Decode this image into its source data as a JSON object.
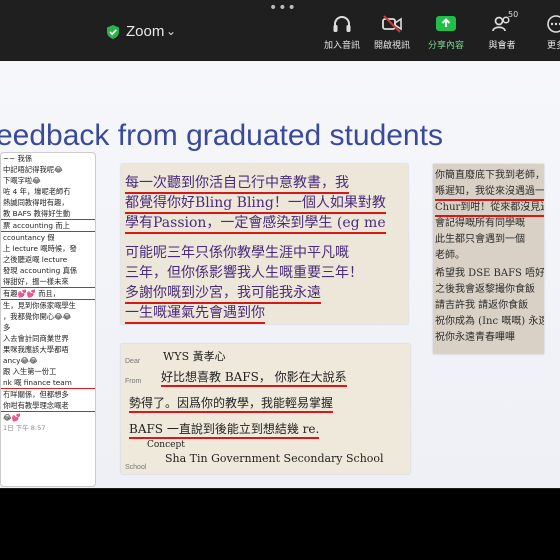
{
  "topbar": {
    "dots": "•••",
    "app_name": "Zoom",
    "buttons": [
      {
        "label": "加入音訊"
      },
      {
        "label": "開啟視訊"
      },
      {
        "label": "分享內容"
      },
      {
        "label": "與會者",
        "count": "50"
      },
      {
        "label": "更多"
      }
    ]
  },
  "slide": {
    "title": "eedback from graduated students",
    "chat_lines": [
      "~~ 我係",
      "中記唔記得我呢😂",
      "",
      "下嘅字啦😂",
      "咗 4 年，壕呢老師冇",
      "熱誠同教得咁有趣，",
      "教 BAFS 教得好生動",
      "票 accounting 而上",
      "ccountancy 假",
      "上 lecture 嘅時候，發",
      "之後聽返嘅 lecture",
      "發現 accounting 真係",
      "得甜好，揾一樣未來",
      "有趣💕💕     而且，",
      "",
      "生，見到你係家嘅學生",
      "，我都覺你開心😂😂",
      "",
      "                         多",
      "入去會計同商業世界",
      "果咪我應該大學都唔",
      "ancy😂😂",
      "跟 入生第一份工",
      "nk 嘅 finance team",
      "冇咩關係，但都想多",
      "你咁有教學理念嘅老",
      "😂💕",
      "",
      "1日 下午 8:57"
    ],
    "card1_lines": [
      "每一次聽到你活自己行中意教書，我",
      "都覺得你好Bling Bling！一個人如果對教",
      "學有Passion，一定會感染到學生 (eg me",
      "可能呢三年只係你教學生涯中平凡嘅",
      "三年，但你係影響我人生嘅重要三年！",
      "多謝你嘅到沙宮，我可能我永遠",
      "一生嘅運氣先會遇到你"
    ],
    "card2": {
      "dear_label": "Dear",
      "dear_value": "WYS 黃孝心",
      "from_label": "From",
      "lines": [
        "好比想喜教 BAFS， 你影在大說系",
        "勢得了。因爲你的教學，我能輕易掌握",
        "BAFS 一直說到後能立到想結幾 re.",
        "Concept"
      ],
      "school_label": "School",
      "school_value": "Sha Tin Government Secondary School"
    },
    "card3_lines": [
      "你簡直廢底下我到老師，",
      "喺遲知，我從來沒遇過一個",
      "Chur到咁！從來都沒見過",
      "會記得嘅所有同學嘅",
      "此生都只會遇到一個",
      "老師。",
      "希望我 DSE BAFS 唔好令你",
      "之後我會返黎撮你食飯",
      "請吉許我 請返你食飯",
      "祝你成為 (Inc 嘅嘅) 永遠健康",
      "祝你永遠青春嗶嗶"
    ]
  }
}
